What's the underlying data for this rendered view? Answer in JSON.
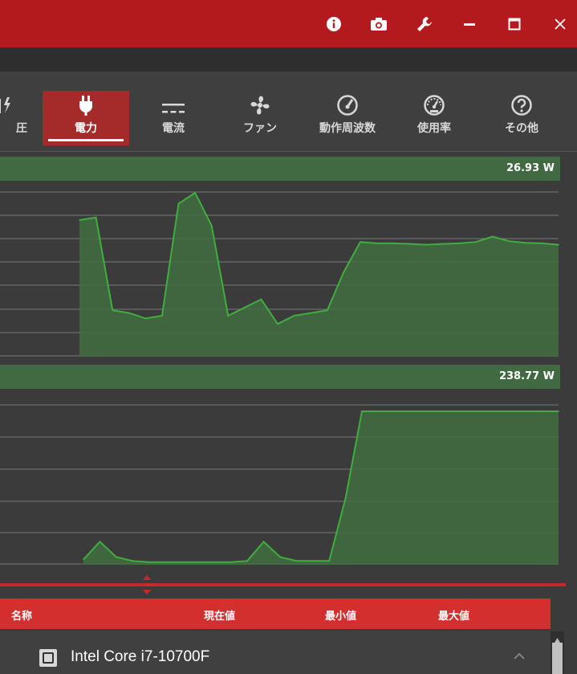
{
  "titlebar": {
    "color": "#b21a1e",
    "buttons": [
      "info-icon",
      "camera-icon",
      "wrench-icon",
      "minimize-icon",
      "maximize-icon",
      "close-icon"
    ]
  },
  "tabs": [
    {
      "label": "圧",
      "icon": "voltage-icon",
      "active": false
    },
    {
      "label": "電力",
      "icon": "plug-icon",
      "active": true
    },
    {
      "label": "電流",
      "icon": "current-icon",
      "active": false
    },
    {
      "label": "ファン",
      "icon": "fan-icon",
      "active": false
    },
    {
      "label": "動作周波数",
      "icon": "speedometer-icon",
      "active": false
    },
    {
      "label": "使用率",
      "icon": "gauge-icon",
      "active": false
    },
    {
      "label": "その他",
      "icon": "question-icon",
      "active": false
    }
  ],
  "charts": {
    "chart1": {
      "value_label": "26.93 W"
    },
    "chart2": {
      "value_label": "238.77 W"
    }
  },
  "chart_data": [
    {
      "type": "area",
      "value_label": "26.93 W",
      "series": [
        {
          "color": "#3fae3f",
          "values": [
            50,
            51,
            17,
            16,
            14,
            15,
            56,
            60,
            48,
            15,
            18,
            21,
            12,
            15,
            16,
            17,
            31,
            42,
            41.5,
            41.5,
            41.3,
            41,
            41.3,
            41.5,
            42,
            44,
            42.3,
            41.7,
            41.5,
            41
          ]
        }
      ]
    },
    {
      "type": "area",
      "value_label": "238.77 W",
      "series": [
        {
          "color": "#3fae3f",
          "values": [
            2,
            9,
            3,
            1.5,
            1,
            1,
            1,
            1,
            1,
            1,
            1.5,
            9,
            3,
            1.5,
            1.5,
            1.5,
            26,
            60,
            60,
            60,
            60,
            60,
            60,
            60,
            60,
            60,
            60,
            60,
            60,
            60
          ]
        }
      ]
    }
  ],
  "table": {
    "headers": {
      "name": "名称",
      "current": "現在値",
      "min": "最小値",
      "max": "最大値"
    },
    "device": "Intel Core i7-10700F"
  }
}
